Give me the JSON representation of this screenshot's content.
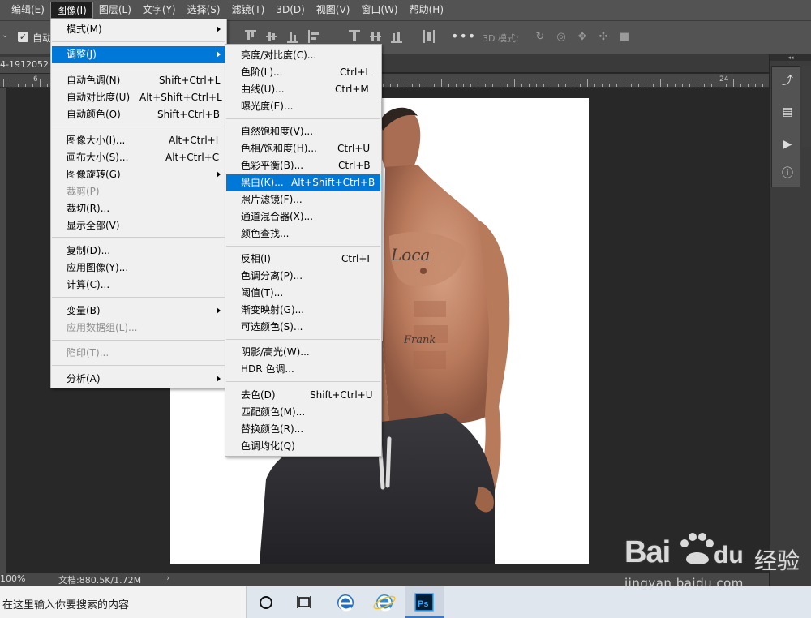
{
  "menubar": {
    "items": [
      "编辑(E)",
      "图像(I)",
      "图层(L)",
      "文字(Y)",
      "选择(S)",
      "滤镜(T)",
      "3D(D)",
      "视图(V)",
      "窗口(W)",
      "帮助(H)"
    ]
  },
  "options": {
    "auto_label": "自动",
    "threed_mode": "3D 模式:",
    "more": "•••"
  },
  "document": {
    "tab_name": "4-1912052",
    "zoom": "100%",
    "doc_info": "文档:880.5K/1.72M",
    "ruler_numbers": [
      "6",
      "24"
    ]
  },
  "image_menu": {
    "items": [
      {
        "label": "模式(M)",
        "shortcut": "",
        "submenu": true
      },
      {
        "label": "调整(J)",
        "shortcut": "",
        "submenu": true,
        "highlighted": true
      },
      {
        "label": "自动色调(N)",
        "shortcut": "Shift+Ctrl+L"
      },
      {
        "label": "自动对比度(U)",
        "shortcut": "Alt+Shift+Ctrl+L"
      },
      {
        "label": "自动颜色(O)",
        "shortcut": "Shift+Ctrl+B"
      },
      {
        "label": "图像大小(I)...",
        "shortcut": "Alt+Ctrl+I"
      },
      {
        "label": "画布大小(S)...",
        "shortcut": "Alt+Ctrl+C"
      },
      {
        "label": "图像旋转(G)",
        "shortcut": "",
        "submenu": true
      },
      {
        "label": "裁剪(P)",
        "shortcut": "",
        "disabled": true
      },
      {
        "label": "裁切(R)...",
        "shortcut": ""
      },
      {
        "label": "显示全部(V)",
        "shortcut": ""
      },
      {
        "label": "复制(D)...",
        "shortcut": ""
      },
      {
        "label": "应用图像(Y)...",
        "shortcut": ""
      },
      {
        "label": "计算(C)...",
        "shortcut": ""
      },
      {
        "label": "变量(B)",
        "shortcut": "",
        "submenu": true
      },
      {
        "label": "应用数据组(L)...",
        "shortcut": "",
        "disabled": true
      },
      {
        "label": "陷印(T)...",
        "shortcut": "",
        "disabled": true
      },
      {
        "label": "分析(A)",
        "shortcut": "",
        "submenu": true
      }
    ]
  },
  "adjust_menu": {
    "items": [
      {
        "label": "亮度/对比度(C)...",
        "shortcut": ""
      },
      {
        "label": "色阶(L)...",
        "shortcut": "Ctrl+L"
      },
      {
        "label": "曲线(U)...",
        "shortcut": "Ctrl+M"
      },
      {
        "label": "曝光度(E)...",
        "shortcut": ""
      },
      {
        "label": "自然饱和度(V)...",
        "shortcut": ""
      },
      {
        "label": "色相/饱和度(H)...",
        "shortcut": "Ctrl+U"
      },
      {
        "label": "色彩平衡(B)...",
        "shortcut": "Ctrl+B"
      },
      {
        "label": "黑白(K)...",
        "shortcut": "Alt+Shift+Ctrl+B",
        "highlighted": true
      },
      {
        "label": "照片滤镜(F)...",
        "shortcut": ""
      },
      {
        "label": "通道混合器(X)...",
        "shortcut": ""
      },
      {
        "label": "颜色查找...",
        "shortcut": ""
      },
      {
        "label": "反相(I)",
        "shortcut": "Ctrl+I"
      },
      {
        "label": "色调分离(P)...",
        "shortcut": ""
      },
      {
        "label": "阈值(T)...",
        "shortcut": ""
      },
      {
        "label": "渐变映射(G)...",
        "shortcut": ""
      },
      {
        "label": "可选颜色(S)...",
        "shortcut": ""
      },
      {
        "label": "阴影/高光(W)...",
        "shortcut": ""
      },
      {
        "label": "HDR 色调...",
        "shortcut": ""
      },
      {
        "label": "去色(D)",
        "shortcut": "Shift+Ctrl+U"
      },
      {
        "label": "匹配颜色(M)...",
        "shortcut": ""
      },
      {
        "label": "替换颜色(R)...",
        "shortcut": ""
      },
      {
        "label": "色调均化(Q)",
        "shortcut": ""
      }
    ]
  },
  "canvas_text": {
    "tattoo_1": "Loca",
    "tattoo_2": "Frank"
  },
  "taskbar": {
    "search_placeholder": "在这里输入你要搜索的内容",
    "ps_label": "Ps"
  },
  "watermark": {
    "logo": "Bai",
    "logo_cn": "经验",
    "url": "jingyan.baidu.com"
  },
  "colors": {
    "menu_highlight": "#0078d7",
    "ps_chrome": "#535353",
    "workspace": "#282828"
  }
}
